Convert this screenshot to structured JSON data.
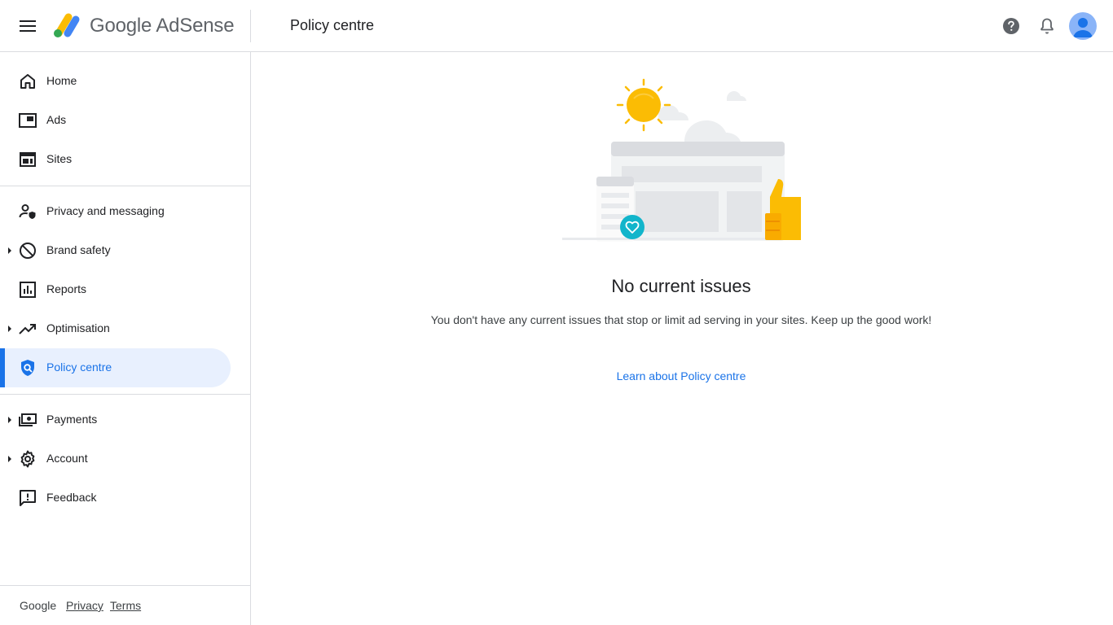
{
  "header": {
    "brand": "Google AdSense",
    "page_title": "Policy centre",
    "icons": {
      "menu": "menu-icon",
      "help": "help-icon",
      "notifications": "bell-icon",
      "account": "avatar-icon"
    }
  },
  "sidebar": {
    "items": [
      {
        "label": "Home",
        "icon": "home-icon",
        "expandable": false,
        "active": false
      },
      {
        "label": "Ads",
        "icon": "ads-icon",
        "expandable": false,
        "active": false
      },
      {
        "label": "Sites",
        "icon": "sites-icon",
        "expandable": false,
        "active": false
      },
      {
        "label": "Privacy and messaging",
        "icon": "privacy-person-icon",
        "expandable": false,
        "active": false
      },
      {
        "label": "Brand safety",
        "icon": "block-icon",
        "expandable": true,
        "active": false
      },
      {
        "label": "Reports",
        "icon": "bar-chart-icon",
        "expandable": false,
        "active": false
      },
      {
        "label": "Optimisation",
        "icon": "trending-up-icon",
        "expandable": true,
        "active": false
      },
      {
        "label": "Policy centre",
        "icon": "policy-shield-icon",
        "expandable": false,
        "active": true
      },
      {
        "label": "Payments",
        "icon": "payments-icon",
        "expandable": true,
        "active": false
      },
      {
        "label": "Account",
        "icon": "gear-icon",
        "expandable": true,
        "active": false
      },
      {
        "label": "Feedback",
        "icon": "feedback-icon",
        "expandable": false,
        "active": false
      }
    ],
    "footer": {
      "google": "Google",
      "privacy": "Privacy",
      "terms": "Terms"
    }
  },
  "main": {
    "title": "No current issues",
    "description": "You don't have any current issues that stop or limit ad serving in your sites. Keep up the good work!",
    "learn_link": "Learn about Policy centre"
  },
  "colors": {
    "accent": "#1a73e8",
    "active_bg": "#e8f0fe",
    "sun": "#fbbc04",
    "heart_badge": "#12b5cb"
  }
}
